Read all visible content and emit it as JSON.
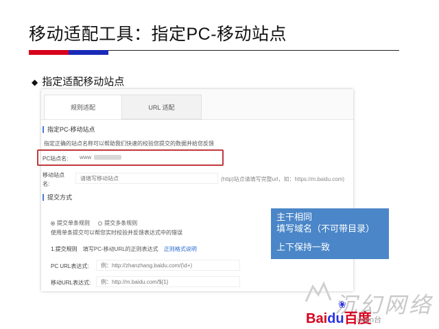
{
  "slide": {
    "title": "移动适配工具：指定PC-移动站点",
    "section_heading": "指定适配移动站点"
  },
  "tabs": [
    {
      "label": "规则适配"
    },
    {
      "label": "URL 适配"
    }
  ],
  "form": {
    "section1_title": "指定PC-移动站点",
    "section1_desc": "指定正确的站点名称可以帮助我们快速的校验您提交的数据并给您反馈",
    "pc_label": "PC站点名:",
    "pc_value": "www",
    "mobile_label_line1": "移动站点",
    "mobile_label_line2": "名:",
    "mobile_placeholder": "请填写移动站点",
    "mobile_hint": "(http)站点请填写完整url，如：https://m.baidu.com)",
    "section2_title": "提交方式",
    "radio_single": "提交单条规则",
    "radio_multi": "提交多条规则",
    "submit_desc": "使用单条提交可以帮您实时校验并反馈表达式中的错误",
    "step_label": "1.提交规则",
    "step_desc": "填写PC-移动URL的正则表达式",
    "step_link": "正则格式说明",
    "pc_regex_label": "PC URL表达式:",
    "pc_regex_placeholder": "例：http://zhanzhang.baidu.com/(\\d+)",
    "mobile_regex_label": "移动URL表达式:",
    "mobile_regex_placeholder": "例：http://m.baidu.com/${1}"
  },
  "callout": {
    "line1": "主干相同",
    "line2": "填写域名（不可带目录）",
    "line3": "上下保持一致"
  },
  "watermark": {
    "chinese": "沉幻网络",
    "brand_bai": "Bai",
    "brand_du": "du",
    "brand_cn": "百度",
    "url": "xiujin台"
  },
  "colors": {
    "accent_red": "#d6001c",
    "accent_blue": "#1a2ab8",
    "callout_bg": "#4a86c8",
    "highlight_border": "#c0383d"
  }
}
